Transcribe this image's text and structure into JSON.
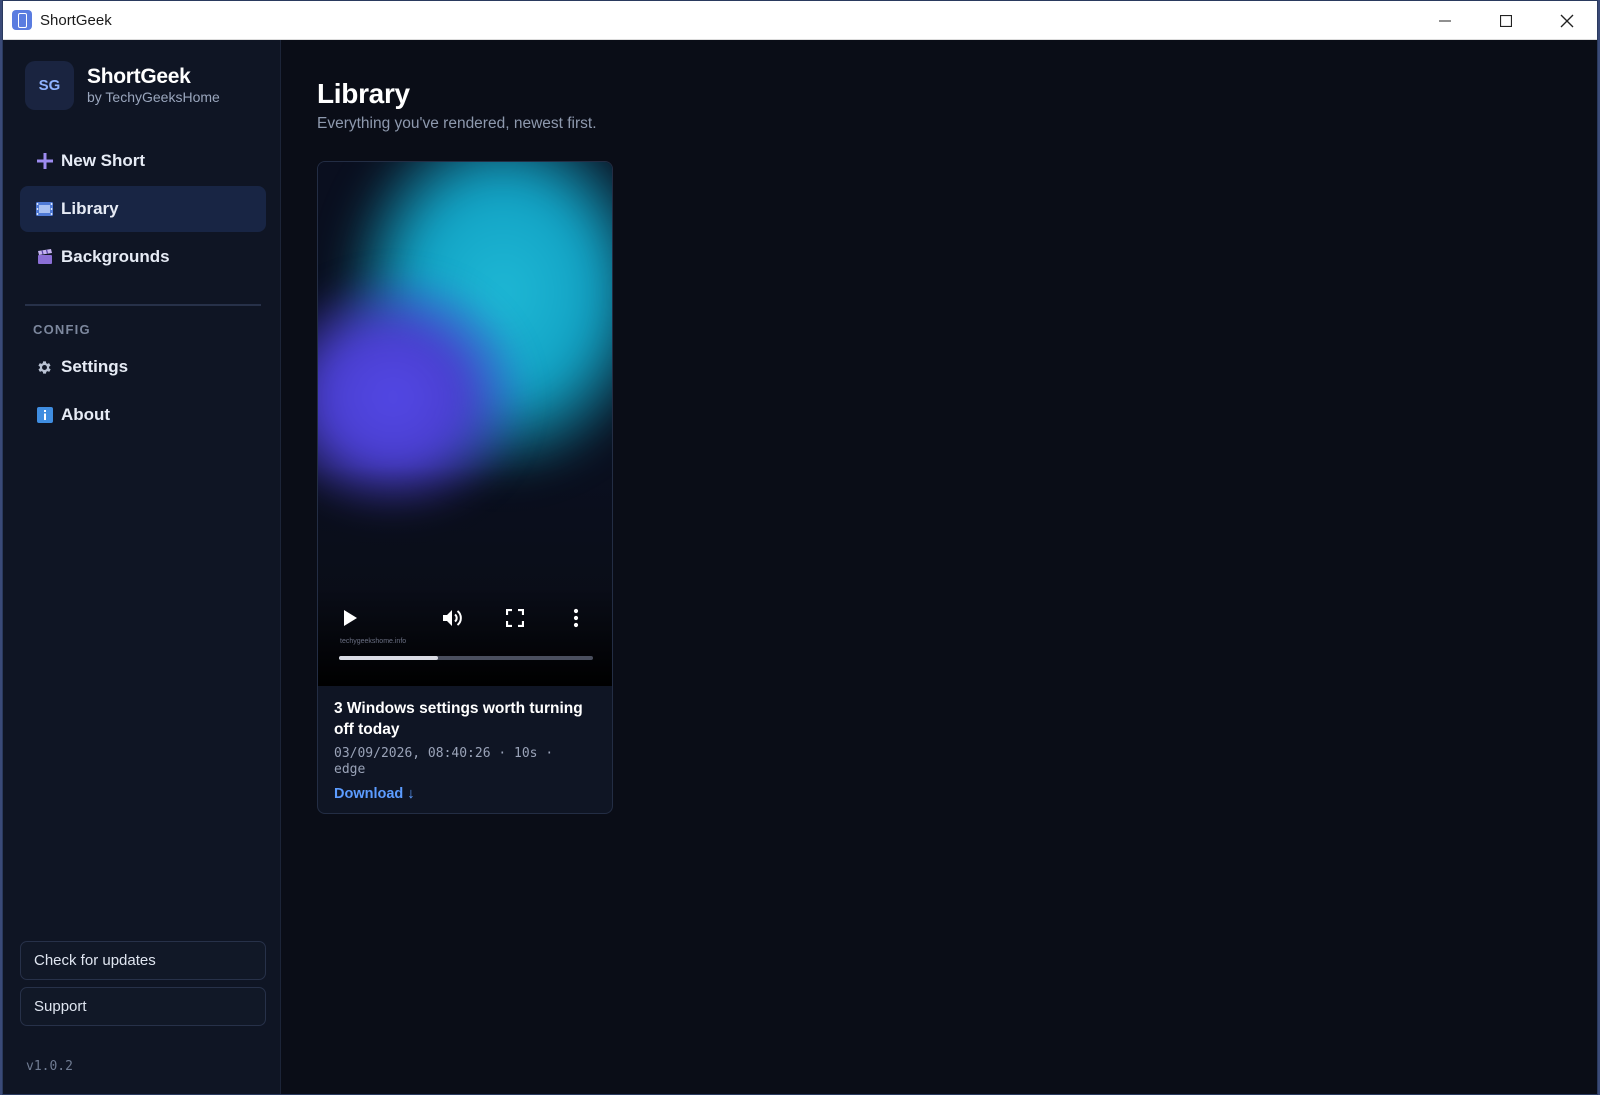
{
  "window": {
    "title": "ShortGeek",
    "controls": {
      "minimize": "minimize-icon",
      "maximize": "maximize-icon",
      "close": "close-icon"
    }
  },
  "sidebar": {
    "logo_text": "SG",
    "brand_name": "ShortGeek",
    "brand_sub": "by TechyGeeksHome",
    "items": [
      {
        "label": "New Short",
        "icon": "plus-icon",
        "active": false
      },
      {
        "label": "Library",
        "icon": "film-icon",
        "active": true
      },
      {
        "label": "Backgrounds",
        "icon": "clapper-icon",
        "active": false
      }
    ],
    "section_label": "CONFIG",
    "config_items": [
      {
        "label": "Settings",
        "icon": "gear-icon"
      },
      {
        "label": "About",
        "icon": "info-icon"
      }
    ],
    "check_updates_label": "Check for updates",
    "support_label": "Support",
    "version": "v1.0.2"
  },
  "main": {
    "title": "Library",
    "subtitle": "Everything you've rendered, newest first.",
    "cards": [
      {
        "title": "3 Windows settings worth turning off today",
        "meta": "03/09/2026, 08:40:26 · 10s · edge",
        "download_label": "Download ↓",
        "video": {
          "watermark": "techygeekshome.info",
          "progress": 0.39,
          "controls": [
            "play-icon",
            "volume-icon",
            "fullscreen-icon",
            "more-options-icon"
          ]
        }
      }
    ]
  },
  "colors": {
    "background": "#0a0d17",
    "sidebar": "#0f1524",
    "active_item": "#182544",
    "accent_link": "#5c9cff",
    "logo_text": "#8fb3ff"
  }
}
